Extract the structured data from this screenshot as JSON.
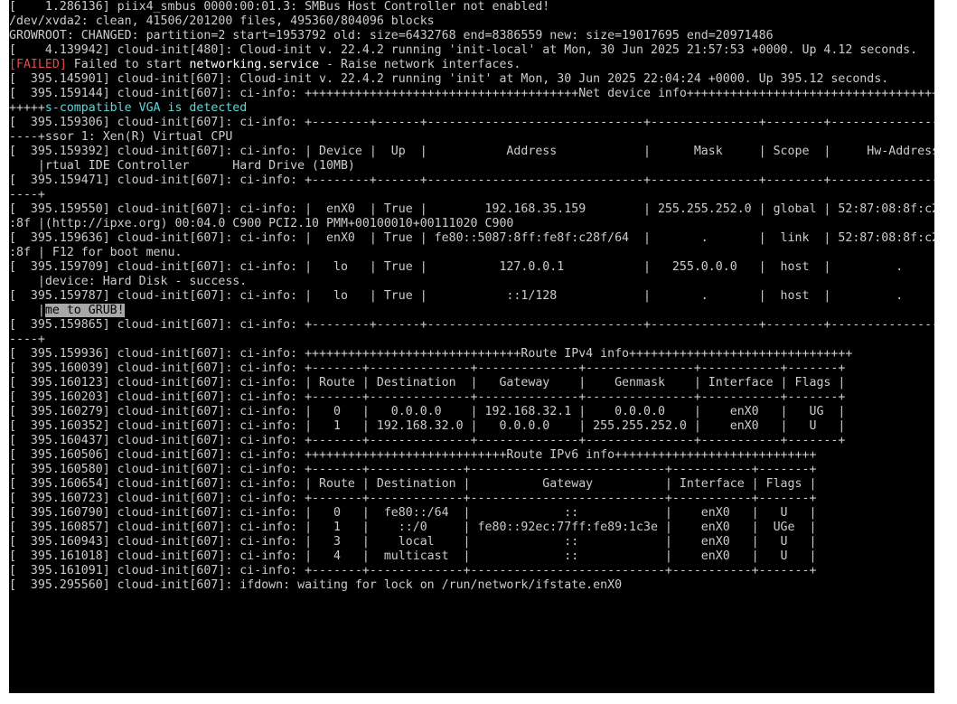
{
  "console": {
    "lines": [
      [
        {
          "t": "[    1.286136] piix4_smbus 0000:00:01.3: SMBus Host Controller not enabled!"
        }
      ],
      [
        {
          "t": "/dev/xvda2: clean, 41506/201200 files, 495360/804096 blocks"
        }
      ],
      [
        {
          "t": "GROWROOT: CHANGED: partition=2 start=1953792 old: size=6432768 end=8386559 new: size=19017695 end=20971486"
        }
      ],
      [
        {
          "t": "[    4.139942] cloud-init[480]: Cloud-init v. 22.4.2 running 'init-local' at Mon, 30 Jun 2025 21:57:53 +0000. Up 4.12 seconds."
        }
      ],
      [
        {
          "t": "[FAILED]",
          "s": "failed"
        },
        {
          "t": " Failed to start "
        },
        {
          "t": "networking.service",
          "s": "white"
        },
        {
          "t": " - Raise network interfaces."
        }
      ],
      [
        {
          "t": "[  395.145901] cloud-init[607]: Cloud-init v. 22.4.2 running 'init' at Mon, 30 Jun 2025 22:04:24 +0000. Up 395.12 seconds."
        }
      ],
      [
        {
          "t": "[  395.159144] cloud-init[607]: ci-info: ++++++++++++++++++++++++++++++++++++++Net device info+++++++++++++++++++++++++++++++++++++++"
        }
      ],
      [
        {
          "t": "+++++"
        },
        {
          "t": "s-compatible VGA is detected",
          "s": "cyan"
        }
      ],
      [
        {
          "t": "[  395.159306] cloud-init[607]: ci-info: +--------+------+------------------------------+---------------+--------+-------------------"
        }
      ],
      [
        {
          "t": "----+ssor 1: Xen(R) Virtual CPU"
        }
      ],
      [
        {
          "t": "[  395.159392] cloud-init[607]: ci-info: | Device |  Up  |           Address            |      Mask     | Scope  |     Hw-Address"
        }
      ],
      [
        {
          "t": "    |rtual IDE Controller      Hard Drive (10MB)"
        }
      ],
      [
        {
          "t": "[  395.159471] cloud-init[607]: ci-info: +--------+------+------------------------------+---------------+--------+-------------------"
        }
      ],
      [
        {
          "t": "----+"
        }
      ],
      [
        {
          "t": "[  395.159550] cloud-init[607]: ci-info: |  enX0  | True |        192.168.35.159        | 255.255.252.0 | global | 52:87:08:8f:c2"
        }
      ],
      [
        {
          "t": ":8f |(http://ipxe.org) 00:04.0 C900 PCI2.10 PMM+00100010+00111020 C900"
        }
      ],
      [
        {
          "t": "[  395.159636] cloud-init[607]: ci-info: |  enX0  | True | fe80::5087:8ff:fe8f:c28f/64  |       .       |  link  | 52:87:08:8f:c2"
        }
      ],
      [
        {
          "t": ":8f | F12 for boot menu."
        }
      ],
      [
        {
          "t": "[  395.159709] cloud-init[607]: ci-info: |   lo   | True |          127.0.0.1           |   255.0.0.0   |  host  |         ."
        }
      ],
      [
        {
          "t": "    |device: Hard Disk - success."
        }
      ],
      [
        {
          "t": "[  395.159787] cloud-init[607]: ci-info: |   lo   | True |           ::1/128            |       .       |  host  |         ."
        }
      ],
      [
        {
          "t": "    |"
        },
        {
          "t": "me to GRUB!",
          "s": "highlight"
        }
      ],
      [
        {
          "t": "[  395.159865] cloud-init[607]: ci-info: +--------+------+------------------------------+---------------+--------+-------------------"
        }
      ],
      [
        {
          "t": "----+"
        }
      ],
      [
        {
          "t": "[  395.159936] cloud-init[607]: ci-info: ++++++++++++++++++++++++++++++Route IPv4 info+++++++++++++++++++++++++++++++"
        }
      ],
      [
        {
          "t": "[  395.160039] cloud-init[607]: ci-info: +-------+--------------+--------------+---------------+-----------+-------+"
        }
      ],
      [
        {
          "t": "[  395.160123] cloud-init[607]: ci-info: | Route | Destination  |   Gateway    |    Genmask    | Interface | Flags |"
        }
      ],
      [
        {
          "t": "[  395.160203] cloud-init[607]: ci-info: +-------+--------------+--------------+---------------+-----------+-------+"
        }
      ],
      [
        {
          "t": "[  395.160279] cloud-init[607]: ci-info: |   0   |   0.0.0.0    | 192.168.32.1 |    0.0.0.0    |    enX0   |   UG  |"
        }
      ],
      [
        {
          "t": "[  395.160352] cloud-init[607]: ci-info: |   1   | 192.168.32.0 |   0.0.0.0    | 255.255.252.0 |    enX0   |   U   |"
        }
      ],
      [
        {
          "t": "[  395.160437] cloud-init[607]: ci-info: +-------+--------------+--------------+---------------+-----------+-------+"
        }
      ],
      [
        {
          "t": "[  395.160506] cloud-init[607]: ci-info: ++++++++++++++++++++++++++++Route IPv6 info++++++++++++++++++++++++++++"
        }
      ],
      [
        {
          "t": "[  395.160580] cloud-init[607]: ci-info: +-------+-------------+---------------------------+-----------+-------+"
        }
      ],
      [
        {
          "t": "[  395.160654] cloud-init[607]: ci-info: | Route | Destination |          Gateway          | Interface | Flags |"
        }
      ],
      [
        {
          "t": "[  395.160723] cloud-init[607]: ci-info: +-------+-------------+---------------------------+-----------+-------+"
        }
      ],
      [
        {
          "t": "[  395.160790] cloud-init[607]: ci-info: |   0   |  fe80::/64  |             ::            |    enX0   |   U   |"
        }
      ],
      [
        {
          "t": "[  395.160857] cloud-init[607]: ci-info: |   1   |    ::/0     | fe80::92ec:77ff:fe89:1c3e |    enX0   |  UGe  |"
        }
      ],
      [
        {
          "t": "[  395.160943] cloud-init[607]: ci-info: |   3   |    local    |             ::            |    enX0   |   U   |"
        }
      ],
      [
        {
          "t": "[  395.161018] cloud-init[607]: ci-info: |   4   |  multicast  |             ::            |    enX0   |   U   |"
        }
      ],
      [
        {
          "t": "[  395.161091] cloud-init[607]: ci-info: +-------+-------------+---------------------------+-----------+-------+"
        }
      ],
      [
        {
          "t": "[  395.295560] cloud-init[607]: ifdown: waiting for lock on /run/network/ifstate.enX0"
        }
      ]
    ]
  }
}
